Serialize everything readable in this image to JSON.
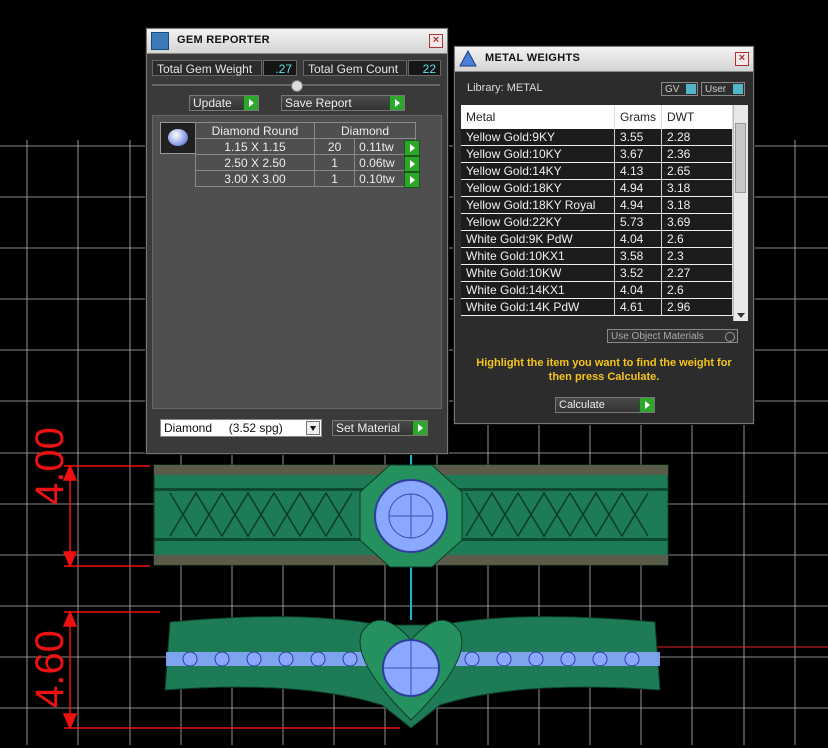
{
  "dimensions": {
    "top": "4.00",
    "bottom": "4.60"
  },
  "gem_reporter": {
    "title": "GEM REPORTER",
    "total_gem_weight_label": "Total Gem Weight",
    "total_gem_weight_value": ".27",
    "total_gem_count_label": "Total Gem Count",
    "total_gem_count_value": "22",
    "update_label": "Update",
    "save_report_label": "Save Report",
    "table_headers": [
      "Diamond Round",
      "Diamond"
    ],
    "rows": [
      {
        "size": "1.15 X 1.15",
        "count": "20",
        "weight": "0.11tw"
      },
      {
        "size": "2.50 X 2.50",
        "count": "1",
        "weight": "0.06tw"
      },
      {
        "size": "3.00 X 3.00",
        "count": "1",
        "weight": "0.10tw"
      }
    ],
    "material_select": "Diamond     (3.52 spg)",
    "set_material_label": "Set Material"
  },
  "metal_weights": {
    "title": "METAL WEIGHTS",
    "library_label": "Library: METAL",
    "gv_label": "GV",
    "user_label": "User",
    "columns": [
      "Metal",
      "Grams",
      "DWT"
    ],
    "rows": [
      {
        "metal": "Yellow Gold:9KY",
        "grams": "3.55",
        "dwt": "2.28"
      },
      {
        "metal": "Yellow Gold:10KY",
        "grams": "3.67",
        "dwt": "2.36"
      },
      {
        "metal": "Yellow Gold:14KY",
        "grams": "4.13",
        "dwt": "2.65"
      },
      {
        "metal": "Yellow Gold:18KY",
        "grams": "4.94",
        "dwt": "3.18"
      },
      {
        "metal": "Yellow Gold:18KY Royal",
        "grams": "4.94",
        "dwt": "3.18"
      },
      {
        "metal": "Yellow Gold:22KY",
        "grams": "5.73",
        "dwt": "3.69"
      },
      {
        "metal": "White Gold:9K PdW",
        "grams": "4.04",
        "dwt": "2.6"
      },
      {
        "metal": "White Gold:10KX1",
        "grams": "3.58",
        "dwt": "2.3"
      },
      {
        "metal": "White Gold:10KW",
        "grams": "3.52",
        "dwt": "2.27"
      },
      {
        "metal": "White Gold:14KX1",
        "grams": "4.04",
        "dwt": "2.6"
      },
      {
        "metal": "White Gold:14K PdW",
        "grams": "4.61",
        "dwt": "2.96"
      }
    ],
    "use_object_materials_label": "Use Object Materials",
    "instruction": "Highlight the item you want to find the weight for then press Calculate.",
    "calculate_label": "Calculate"
  }
}
